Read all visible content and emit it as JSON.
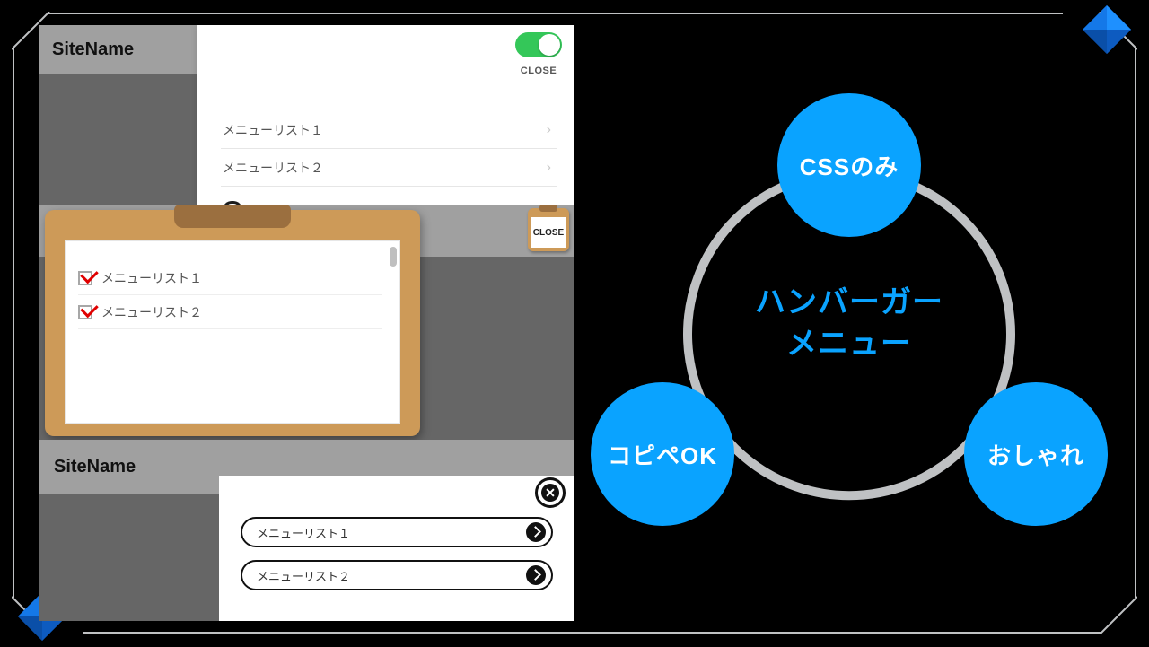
{
  "panel1": {
    "site_name": "SiteName",
    "close_label": "CLOSE",
    "menu": [
      "メニューリスト１",
      "メニューリスト２"
    ]
  },
  "panel2": {
    "close_label": "CLOSE",
    "menu": [
      "メニューリスト１",
      "メニューリスト２"
    ]
  },
  "panel3": {
    "site_name": "SiteName",
    "menu": [
      "メニューリスト１",
      "メニューリスト２"
    ]
  },
  "diagram": {
    "center_line1": "ハンバーガー",
    "center_line2": "メニュー",
    "bubble_top": "CSSのみ",
    "bubble_bl": "コピペOK",
    "bubble_br": "おしゃれ"
  }
}
